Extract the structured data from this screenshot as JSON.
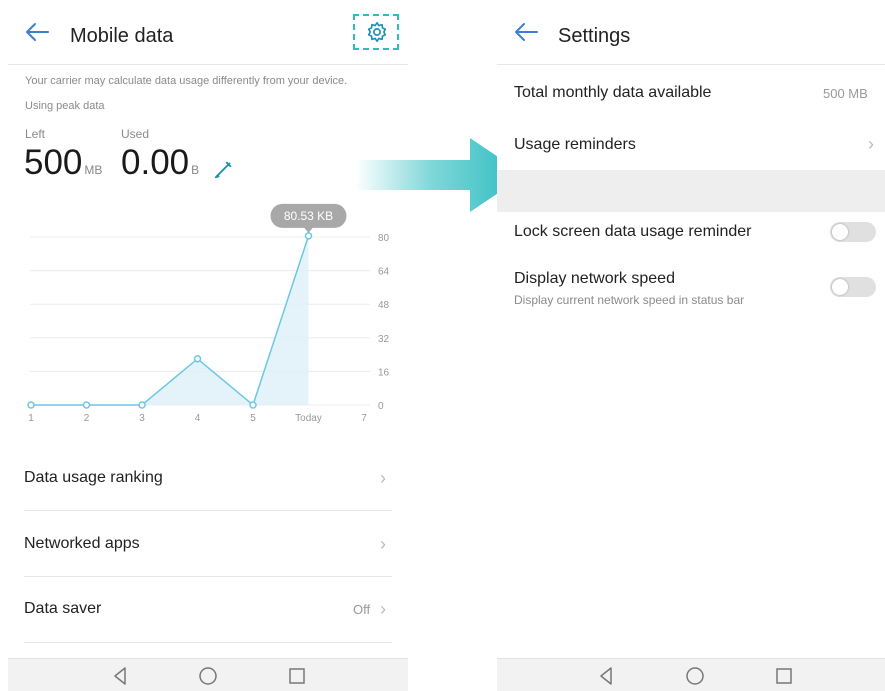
{
  "left_screen": {
    "title": "Mobile data",
    "carrier_note": "Your carrier may calculate data usage differently from your device.",
    "peak_note": "Using peak data",
    "left_label": "Left",
    "left_value": "500",
    "left_unit": "MB",
    "used_label": "Used",
    "used_value": "0.00",
    "used_unit": "B",
    "menu": [
      {
        "label": "Data usage ranking",
        "value": ""
      },
      {
        "label": "Networked apps",
        "value": ""
      },
      {
        "label": "Data saver",
        "value": "Off"
      }
    ]
  },
  "right_screen": {
    "title": "Settings",
    "total_label": "Total monthly data available",
    "total_value": "500 MB",
    "reminders_label": "Usage reminders",
    "lock_label": "Lock screen data usage reminder",
    "lock_enabled": false,
    "speed_label": "Display network speed",
    "speed_desc": "Display current network speed in status bar",
    "speed_enabled": false
  },
  "colors": {
    "accent": "#2bbcc0",
    "chart_line": "#6cc8e4",
    "chart_fill": "#dff1f8",
    "tooltip": "#a8a8a8"
  },
  "icons": [
    "back-arrow-icon",
    "gear-icon",
    "pencil-icon",
    "chevron-right-icon",
    "nav-back-icon",
    "nav-home-icon",
    "nav-recent-icon",
    "right-arrow-icon"
  ],
  "chart_data": {
    "type": "area",
    "x": [
      "1",
      "2",
      "3",
      "4",
      "5",
      "Today",
      "7"
    ],
    "values": [
      0,
      0,
      0,
      22,
      0,
      80.53
    ],
    "yticks": [
      0,
      16,
      32,
      48,
      64,
      80
    ],
    "ylim": [
      0,
      80
    ],
    "annotation": "80.53 KB",
    "grid": true
  }
}
